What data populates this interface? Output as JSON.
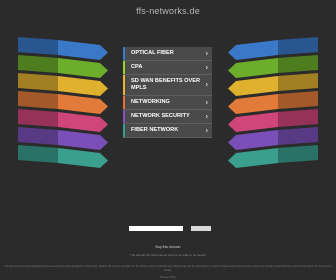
{
  "header": {
    "domain": "ffs-networks.de"
  },
  "menu": {
    "items": [
      {
        "label": "OPTICAL FIBER",
        "color": "#2e7fd6"
      },
      {
        "label": "CPA",
        "color": "#9bd32a"
      },
      {
        "label": "SD WAN BENEFITS OVER MPLS",
        "color": "#e8b630"
      },
      {
        "label": "NETWORKING",
        "color": "#e8702a"
      },
      {
        "label": "NETWORK SECURITY",
        "color": "#8a4fc4"
      },
      {
        "label": "FIBER NETWORK",
        "color": "#2ba38f"
      }
    ],
    "chevron": "›"
  },
  "wing_colors": [
    "#3a78c8",
    "#6cae2c",
    "#e0b12f",
    "#e27b3a",
    "#d0457a",
    "#7a4fb8",
    "#3a9f8c"
  ],
  "search": {
    "placeholder": ""
  },
  "footer": {
    "buy_domain": "Buy this domain",
    "copyright": "The domain ffs-networks.de may be for sale by its owner!",
    "privacy_text": "The Sponsored Listings displayed above are served automatically by a third party. Neither the service provider nor the domain owner maintain any relationship with the advertisers. In case of trademark issues please contact the domain owner directly (contact information can be found in whois).",
    "privacy_link": "Privacy Policy"
  }
}
